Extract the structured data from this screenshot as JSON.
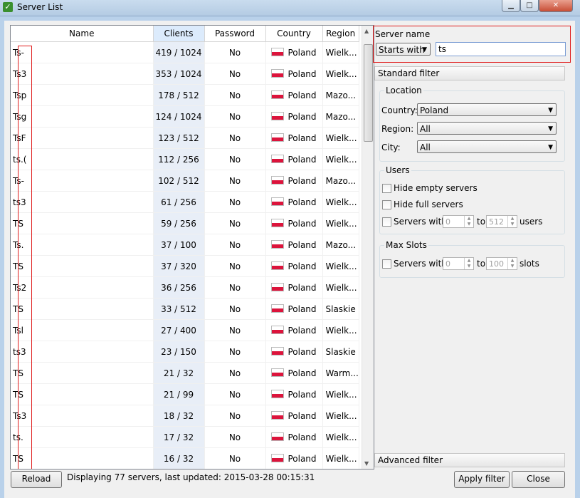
{
  "window": {
    "title": "Server List"
  },
  "table": {
    "columns": [
      "Name",
      "Clients",
      "Password",
      "Country",
      "Region"
    ],
    "rows": [
      {
        "name": "Ts-",
        "clients": "419 / 1024",
        "password": "No",
        "country": "Poland",
        "region": "Wielk..."
      },
      {
        "name": "Ts3",
        "clients": "353 / 1024",
        "password": "No",
        "country": "Poland",
        "region": "Wielk..."
      },
      {
        "name": "Tsp",
        "clients": "178 / 512",
        "password": "No",
        "country": "Poland",
        "region": "Mazo..."
      },
      {
        "name": "Tsg",
        "clients": "124 / 1024",
        "password": "No",
        "country": "Poland",
        "region": "Mazo..."
      },
      {
        "name": "TsF",
        "clients": "123 / 512",
        "password": "No",
        "country": "Poland",
        "region": "Wielk..."
      },
      {
        "name": "ts.(",
        "clients": "112 / 256",
        "password": "No",
        "country": "Poland",
        "region": "Wielk..."
      },
      {
        "name": "Ts-",
        "clients": "102 / 512",
        "password": "No",
        "country": "Poland",
        "region": "Mazo..."
      },
      {
        "name": "ts3",
        "clients": "61 / 256",
        "password": "No",
        "country": "Poland",
        "region": "Wielk..."
      },
      {
        "name": "TS",
        "clients": "59 / 256",
        "password": "No",
        "country": "Poland",
        "region": "Wielk..."
      },
      {
        "name": "Ts.",
        "clients": "37 / 100",
        "password": "No",
        "country": "Poland",
        "region": "Mazo..."
      },
      {
        "name": "TS",
        "clients": "37 / 320",
        "password": "No",
        "country": "Poland",
        "region": "Wielk..."
      },
      {
        "name": "Ts2",
        "clients": "36 / 256",
        "password": "No",
        "country": "Poland",
        "region": "Wielk..."
      },
      {
        "name": "TS",
        "clients": "33 / 512",
        "password": "No",
        "country": "Poland",
        "region": "Slaskie"
      },
      {
        "name": "Tsl",
        "clients": "27 / 400",
        "password": "No",
        "country": "Poland",
        "region": "Wielk..."
      },
      {
        "name": "ts3",
        "clients": "23 / 150",
        "password": "No",
        "country": "Poland",
        "region": "Slaskie"
      },
      {
        "name": "TS",
        "clients": "21 / 32",
        "password": "No",
        "country": "Poland",
        "region": "Warm..."
      },
      {
        "name": "TS",
        "clients": "21 / 99",
        "password": "No",
        "country": "Poland",
        "region": "Wielk..."
      },
      {
        "name": "Ts3",
        "clients": "18 / 32",
        "password": "No",
        "country": "Poland",
        "region": "Wielk..."
      },
      {
        "name": "ts.",
        "clients": "17 / 32",
        "password": "No",
        "country": "Poland",
        "region": "Wielk..."
      },
      {
        "name": "TS",
        "clients": "16 / 32",
        "password": "No",
        "country": "Poland",
        "region": "Wielk..."
      }
    ]
  },
  "footer": {
    "reload_label": "Reload",
    "status": "Displaying 77 servers, last updated: 2015-03-28 00:15:31",
    "apply_label": "Apply filter",
    "close_label": "Close"
  },
  "filter": {
    "server_name_title": "Server name",
    "match_mode": "Starts with",
    "search_value": "ts",
    "standard_filter_label": "Standard filter",
    "advanced_filter_label": "Advanced filter",
    "location": {
      "title": "Location",
      "country_label": "Country:",
      "country_value": "Poland",
      "region_label": "Region:",
      "region_value": "All",
      "city_label": "City:",
      "city_value": "All"
    },
    "users": {
      "title": "Users",
      "hide_empty": "Hide empty servers",
      "hide_full": "Hide full servers",
      "servers_with": "Servers with",
      "min": "0",
      "to": "to",
      "max": "512",
      "unit": "users"
    },
    "max_slots": {
      "title": "Max Slots",
      "servers_with": "Servers with",
      "min": "0",
      "to": "to",
      "max": "100",
      "unit": "slots"
    }
  }
}
